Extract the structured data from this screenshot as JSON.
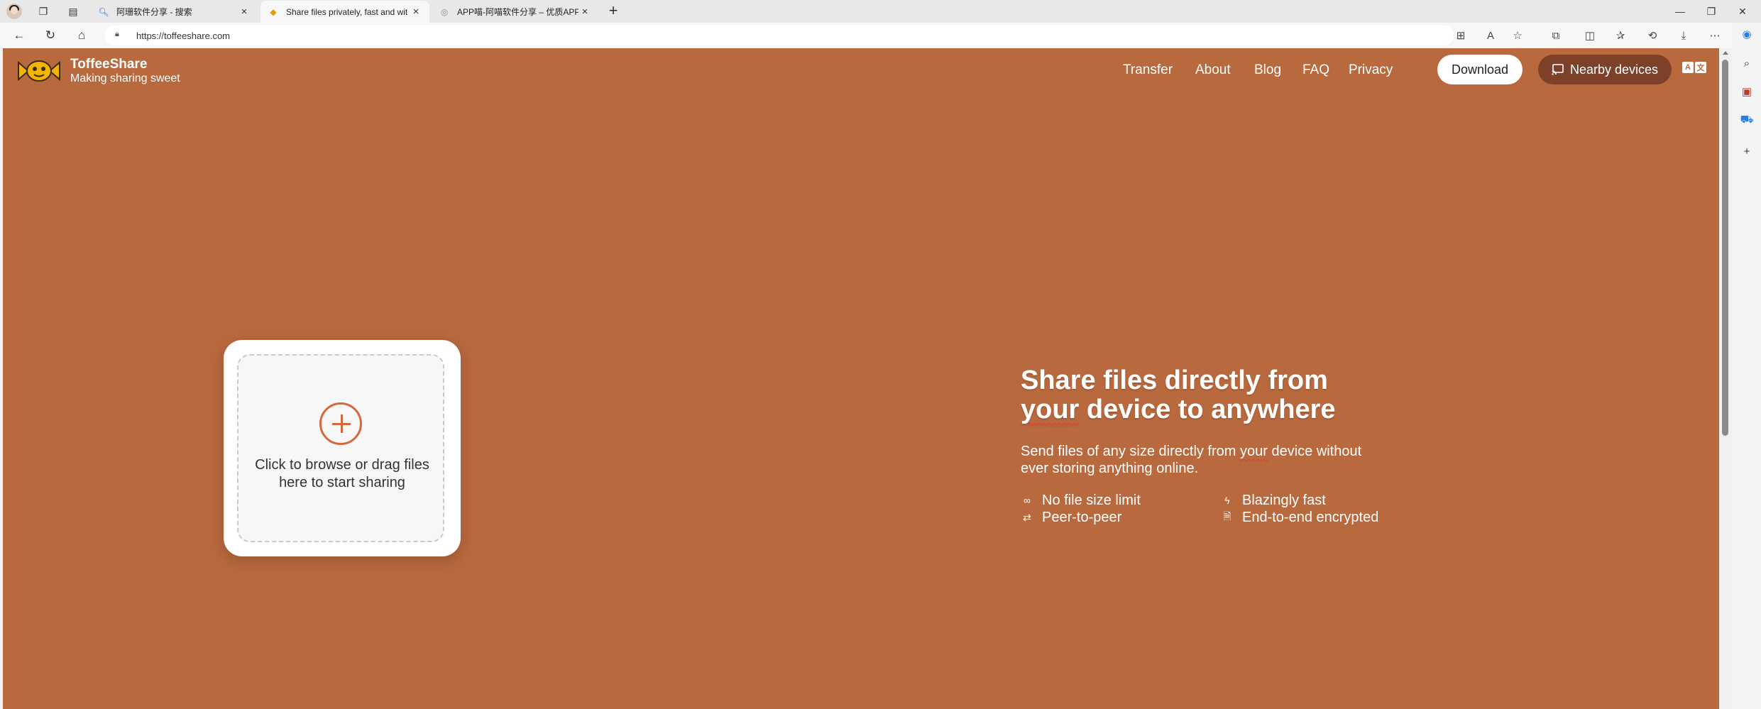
{
  "browser": {
    "tabs": [
      {
        "title": "阿珊软件分享 - 搜索",
        "icon": "search-icon"
      },
      {
        "title": "Share files privately, fast and wit",
        "icon": "toffee-favicon"
      },
      {
        "title": "APP喵-阿喵软件分享 – 优质APP",
        "icon": "app-favicon"
      }
    ],
    "url": "https://toffeeshare.com"
  },
  "page": {
    "brand": {
      "name": "ToffeeShare",
      "tagline": "Making sharing sweet"
    },
    "nav": [
      "Transfer",
      "About",
      "Blog",
      "FAQ",
      "Privacy"
    ],
    "download_label": "Download",
    "nearby_label": "Nearby devices",
    "lang_icon": [
      "A",
      "文"
    ],
    "drop_text": "Click to browse or drag files here to start sharing",
    "hero": {
      "title_line1": "Share files directly from",
      "title_line2_a": "your",
      "title_line2_b": " device to anywhere",
      "sub_a": "Send files of any size directly from ",
      "sub_b": "your",
      "sub_c": " device without ever storing anything online."
    },
    "features": [
      {
        "label": "No file size limit",
        "icon": "infinity-icon"
      },
      {
        "label": "Peer-to-peer",
        "icon": "swap-icon"
      },
      {
        "label": "Blazingly fast",
        "icon": "lightning-icon"
      },
      {
        "label": "End-to-end encrypted",
        "icon": "lock-file-icon"
      }
    ]
  },
  "colors": {
    "page_bg": "#b9693e",
    "accent": "#d3693c",
    "nearby_bg": "#7d412a"
  }
}
